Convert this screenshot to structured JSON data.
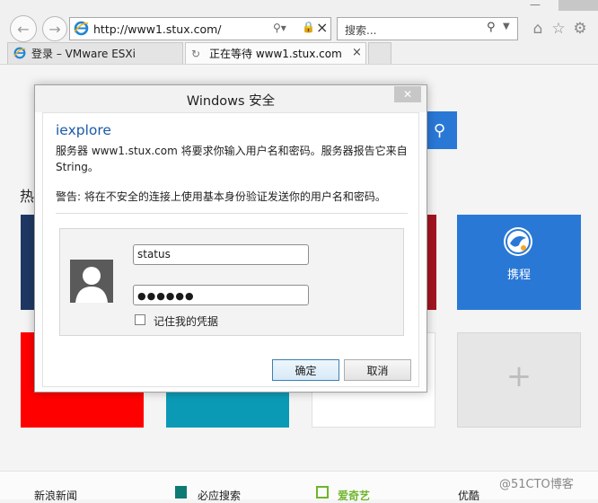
{
  "browser": {
    "address_url": "http://www1.stux.com/",
    "search_placeholder": "搜索...",
    "tabs": [
      {
        "label": "登录 – VMware ESXi"
      },
      {
        "label": "正在等待 www1.stux.com"
      }
    ]
  },
  "page": {
    "section_heading_partial": "热",
    "tiles": [
      {
        "label": "携程"
      },
      {
        "label": "+"
      }
    ],
    "bottom_links": [
      "新浪新闻",
      "必应搜索",
      "爱奇艺",
      "优酷"
    ],
    "watermark": "@51CTO博客"
  },
  "dialog": {
    "title": "Windows 安全",
    "app_name": "iexplore",
    "message": "服务器 www1.stux.com 将要求你输入用户名和密码。服务器报告它来自 String。",
    "warning": "警告: 将在不安全的连接上使用基本身份验证发送你的用户名和密码。",
    "username_value": "status",
    "password_mask": "●●●●●●",
    "remember_label": "记住我的凭据",
    "ok_label": "确定",
    "cancel_label": "取消"
  },
  "colors": {
    "link_blue": "#1b5aa8",
    "tile_blue": "#2a78d6",
    "tile_red": "#ff0000",
    "tile_teal": "#0b9ab5",
    "tile_navy": "#1f3863",
    "tile_darkred": "#a31420"
  }
}
